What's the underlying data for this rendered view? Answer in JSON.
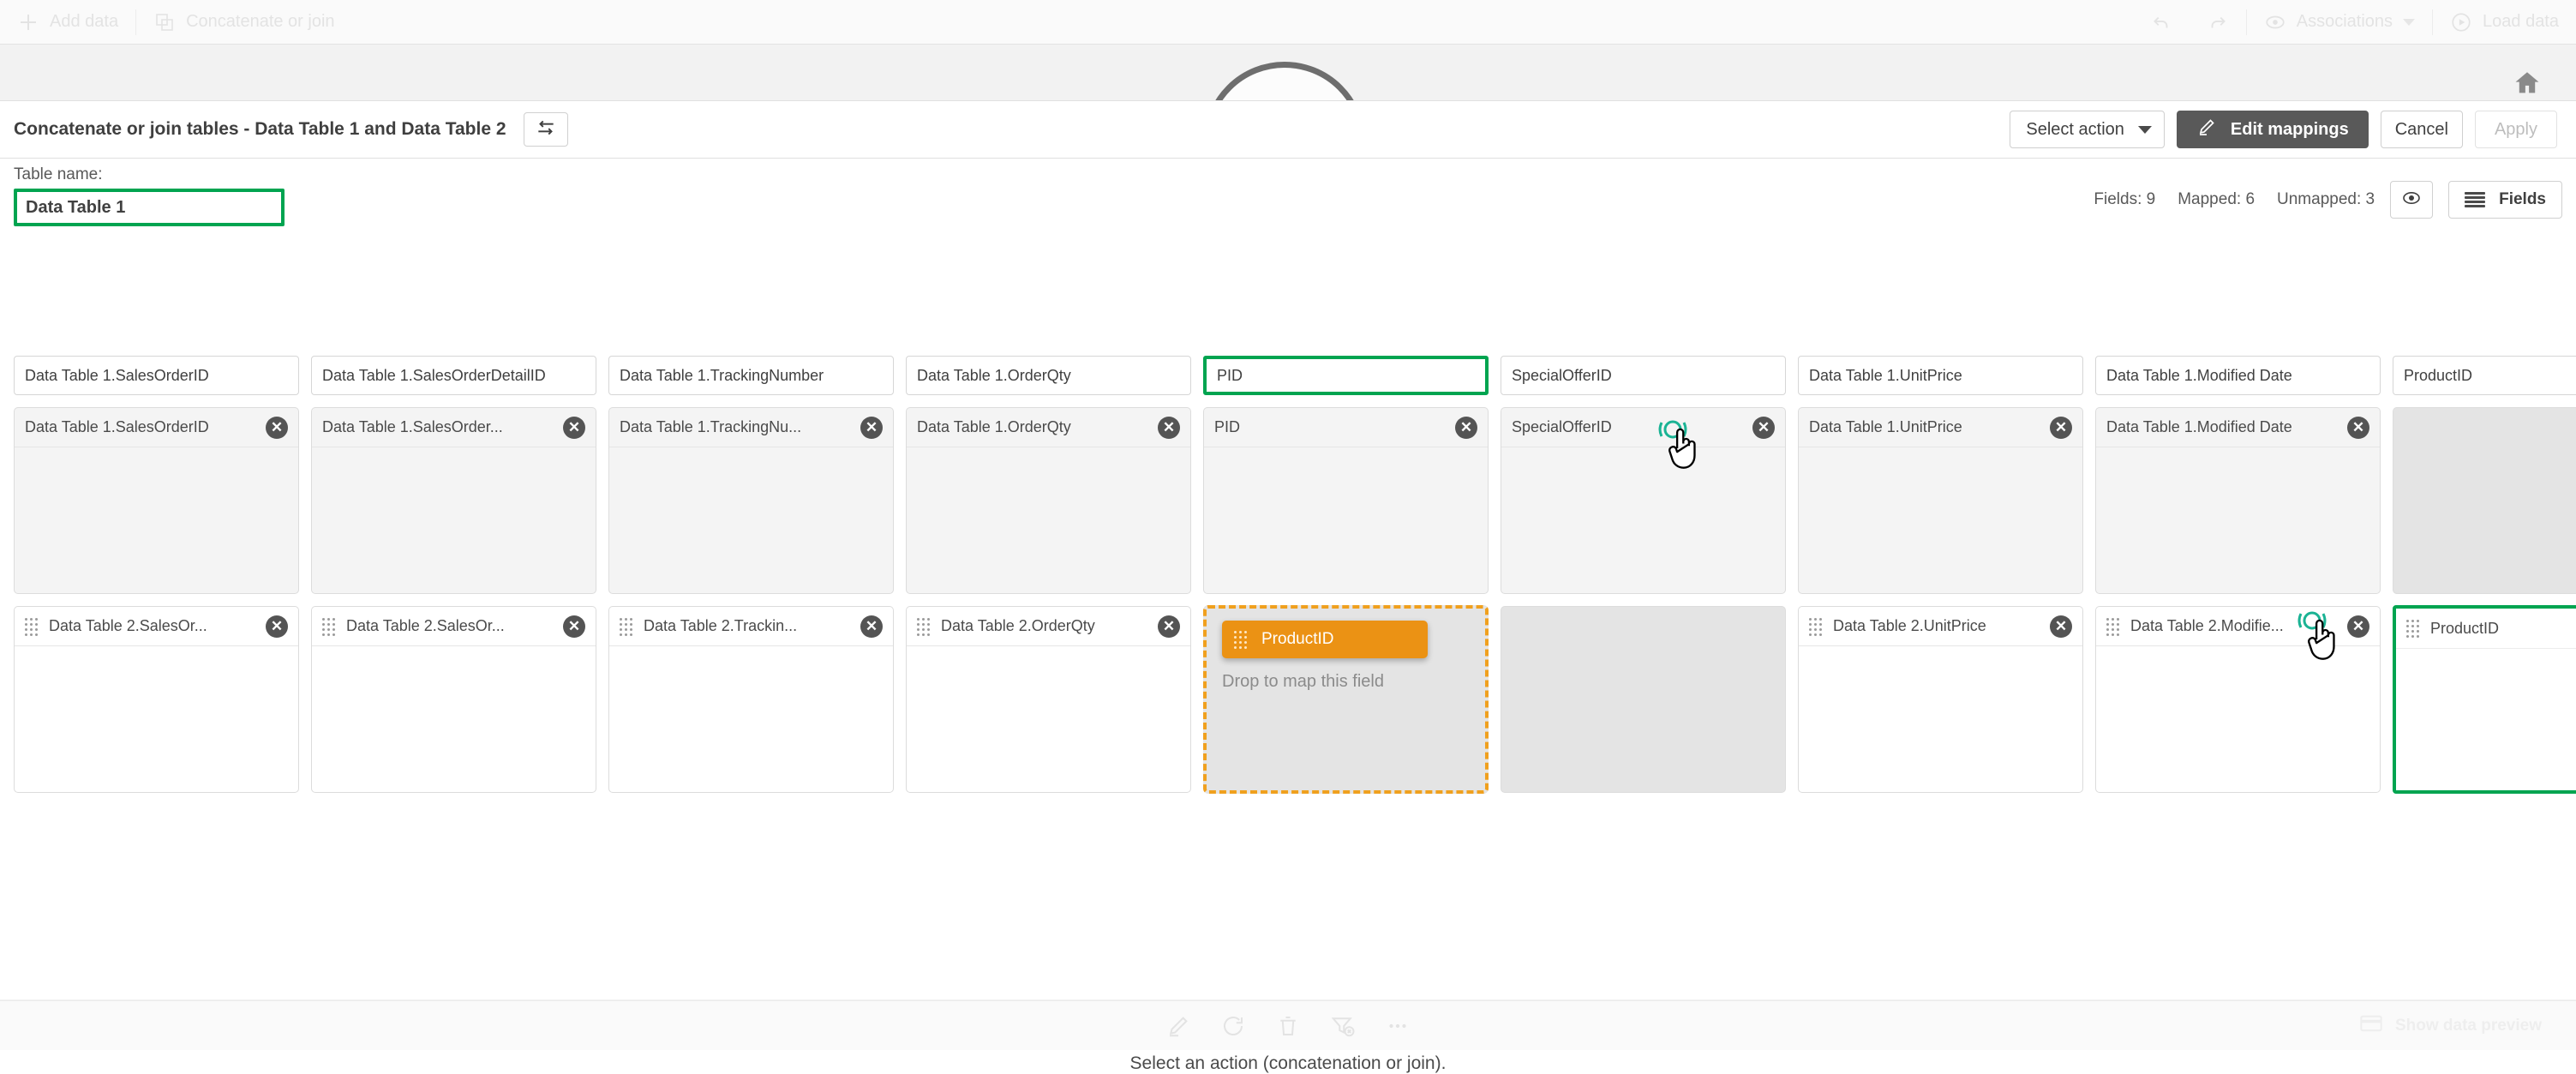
{
  "app_toolbar": {
    "add_data": "Add data",
    "concatenate_or_join": "Concatenate or join",
    "associations": "Associations",
    "load_data": "Load data",
    "icons": {
      "plus": "plus-icon",
      "concat": "concatenate-icon",
      "undo": "undo-icon",
      "redo": "redo-icon",
      "eye": "eye-icon",
      "caret": "chevron-down-icon",
      "play": "play-circle-icon",
      "home": "home-icon"
    }
  },
  "panel": {
    "title": "Concatenate or join tables - Data Table 1 and Data Table 2",
    "swap_icon": "swap-arrows-icon",
    "select_action": "Select action",
    "edit_mappings": "Edit mappings",
    "edit_mappings_icon": "pencil-icon",
    "cancel": "Cancel",
    "apply": "Apply"
  },
  "table_name": {
    "label": "Table name:",
    "value": "Data Table 1",
    "placeholder": "Table name"
  },
  "fields_status": {
    "fields": "Fields: 9",
    "mapped": "Mapped: 6",
    "unmapped": "Unmapped: 3",
    "eye_icon": "eye-icon",
    "fields_button": "Fields"
  },
  "columns": [
    {
      "header": "Data Table 1.SalesOrderID",
      "selected": false,
      "top": {
        "label": "Data Table 1.SalesOrderID",
        "style": "grey",
        "grip": false,
        "close": true
      },
      "bottom": {
        "label": "Data Table 2.SalesOr...",
        "style": "white",
        "grip": true,
        "close": true
      }
    },
    {
      "header": "Data Table 1.SalesOrderDetailID",
      "selected": false,
      "top": {
        "label": "Data Table 1.SalesOrder...",
        "style": "grey",
        "grip": false,
        "close": true
      },
      "bottom": {
        "label": "Data Table 2.SalesOr...",
        "style": "white",
        "grip": true,
        "close": true
      }
    },
    {
      "header": "Data Table 1.TrackingNumber",
      "selected": false,
      "top": {
        "label": "Data Table 1.TrackingNu...",
        "style": "grey",
        "grip": false,
        "close": true
      },
      "bottom": {
        "label": "Data Table 2.Trackin...",
        "style": "white",
        "grip": true,
        "close": true
      }
    },
    {
      "header": "Data Table 1.OrderQty",
      "selected": false,
      "top": {
        "label": "Data Table 1.OrderQty",
        "style": "grey",
        "grip": false,
        "close": true
      },
      "bottom": {
        "label": "Data Table 2.OrderQty",
        "style": "white",
        "grip": true,
        "close": true
      }
    },
    {
      "header": "PID",
      "selected": true,
      "top": {
        "label": "PID",
        "style": "grey",
        "grip": false,
        "close": true
      },
      "bottom": {
        "style": "drop-target",
        "drag_chip": "ProductID",
        "drop_hint": "Drop to map this field"
      }
    },
    {
      "header": "SpecialOfferID",
      "selected": false,
      "top": {
        "label": "SpecialOfferID",
        "style": "grey",
        "grip": false,
        "close": true,
        "click_indicator": true
      },
      "bottom": {
        "style": "empty-grey"
      }
    },
    {
      "header": "Data Table 1.UnitPrice",
      "selected": false,
      "top": {
        "label": "Data Table 1.UnitPrice",
        "style": "grey",
        "grip": false,
        "close": true
      },
      "bottom": {
        "label": "Data Table 2.UnitPrice",
        "style": "white",
        "grip": true,
        "close": true
      }
    },
    {
      "header": "Data Table 1.Modified Date",
      "selected": false,
      "top": {
        "label": "Data Table 1.Modified Date",
        "style": "grey",
        "grip": false,
        "close": true
      },
      "bottom": {
        "label": "Data Table 2.Modifie...",
        "style": "white",
        "grip": true,
        "close": true
      }
    },
    {
      "header": "ProductID",
      "selected": false,
      "top": {
        "style": "empty-grey"
      },
      "bottom": {
        "label": "ProductID",
        "style": "green-sel",
        "grip": true,
        "close": true,
        "click_indicator": true
      }
    }
  ],
  "footer": {
    "message": "Select an action (concatenation or join).",
    "icons": [
      "pencil-icon",
      "refresh-icon",
      "trash-icon",
      "clear-filter-icon",
      "more-ellipsis-icon"
    ],
    "show_data_preview": "Show data preview",
    "preview_icon": "preview-panel-icon"
  },
  "colors": {
    "accent_green": "#00a450",
    "drag_orange": "#eb9214",
    "drop_border_orange": "#f0a01e",
    "dark_button": "#595959",
    "click_ring_teal": "#1ab394"
  }
}
